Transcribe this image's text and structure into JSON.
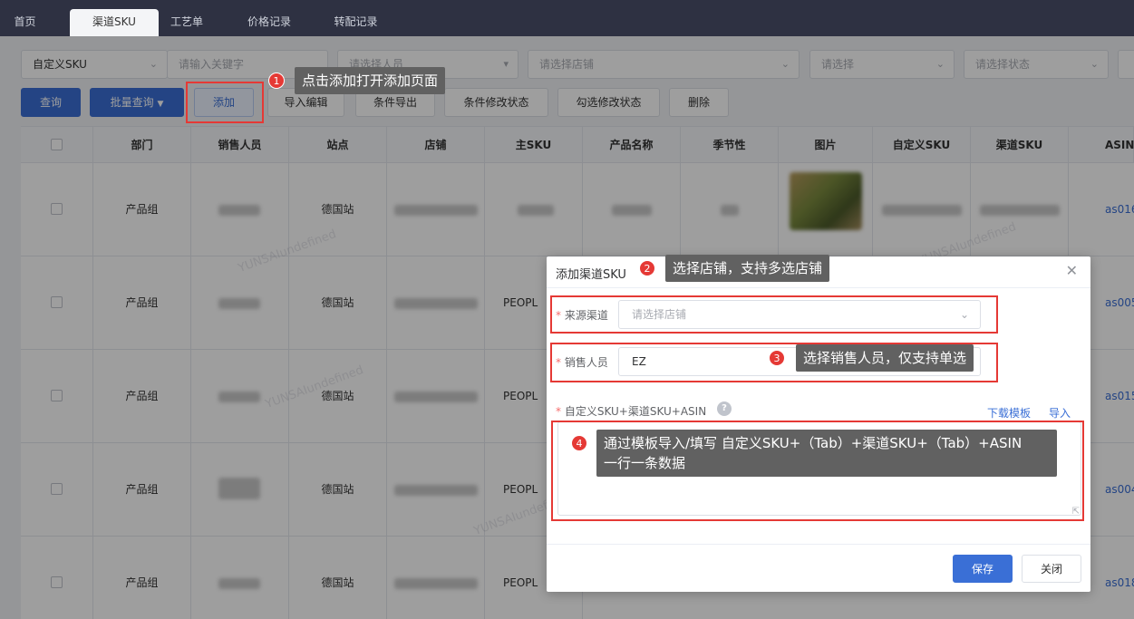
{
  "tabs": [
    {
      "label": "首页",
      "active": false
    },
    {
      "label": "渠道SKU",
      "active": true
    },
    {
      "label": "工艺单",
      "active": false
    },
    {
      "label": "价格记录",
      "active": false
    },
    {
      "label": "转配记录",
      "active": false
    }
  ],
  "filters": {
    "custom_sku_select": "自定义SKU",
    "keyword_placeholder": "请输入关键字",
    "sales_placeholder": "请选择人员",
    "shop_placeholder": "请选择店铺",
    "generic_placeholder": "请选择",
    "status_placeholder": "请选择状态"
  },
  "toolbar": {
    "query": "查询",
    "batch_query": "批量查询",
    "add": "添加",
    "import_edit": "导入编辑",
    "condition_export": "条件导出",
    "condition_modify_status": "条件修改状态",
    "check_modify_status": "勾选修改状态",
    "delete": "删除"
  },
  "table": {
    "columns": [
      "部门",
      "销售人员",
      "站点",
      "店铺",
      "主SKU",
      "产品名称",
      "季节性",
      "图片",
      "自定义SKU",
      "渠道SKU",
      "ASIN"
    ],
    "rows": [
      {
        "dept": "产品组",
        "site": "德国站",
        "shop": "",
        "asin": "as016"
      },
      {
        "dept": "产品组",
        "site": "德国站",
        "shop": "PEOPL",
        "asin": "as005"
      },
      {
        "dept": "产品组",
        "site": "德国站",
        "shop": "PEOPL",
        "asin": "as015"
      },
      {
        "dept": "产品组",
        "site": "德国站",
        "shop": "PEOPL",
        "asin": "as004"
      },
      {
        "dept": "产品组",
        "site": "德国站",
        "shop": "PEOPL",
        "asin": "as018"
      }
    ]
  },
  "dialog": {
    "title": "添加渠道SKU",
    "source_label": "来源渠道",
    "source_placeholder": "请选择店铺",
    "sales_label": "销售人员",
    "sales_value": "EZ",
    "sku_label": "自定义SKU+渠道SKU+ASIN",
    "download_template": "下载模板",
    "import": "导入",
    "save": "保存",
    "close": "关闭"
  },
  "annotations": {
    "a1": {
      "num": "1",
      "text": "点击添加打开添加页面"
    },
    "a2": {
      "num": "2",
      "text": "选择店铺，支持多选店铺"
    },
    "a3": {
      "num": "3",
      "text": "选择销售人员，仅支持单选"
    },
    "a4": {
      "num": "4",
      "line1": "通过模板导入/填写 自定义SKU+（Tab）+渠道SKU+（Tab）+ASIN",
      "line2": "一行一条数据"
    }
  },
  "watermark": "YUNSAIundefined",
  "colors": {
    "primary": "#3a6fd6",
    "annotation_red": "#e53935",
    "tabbar": "#2e3142"
  }
}
